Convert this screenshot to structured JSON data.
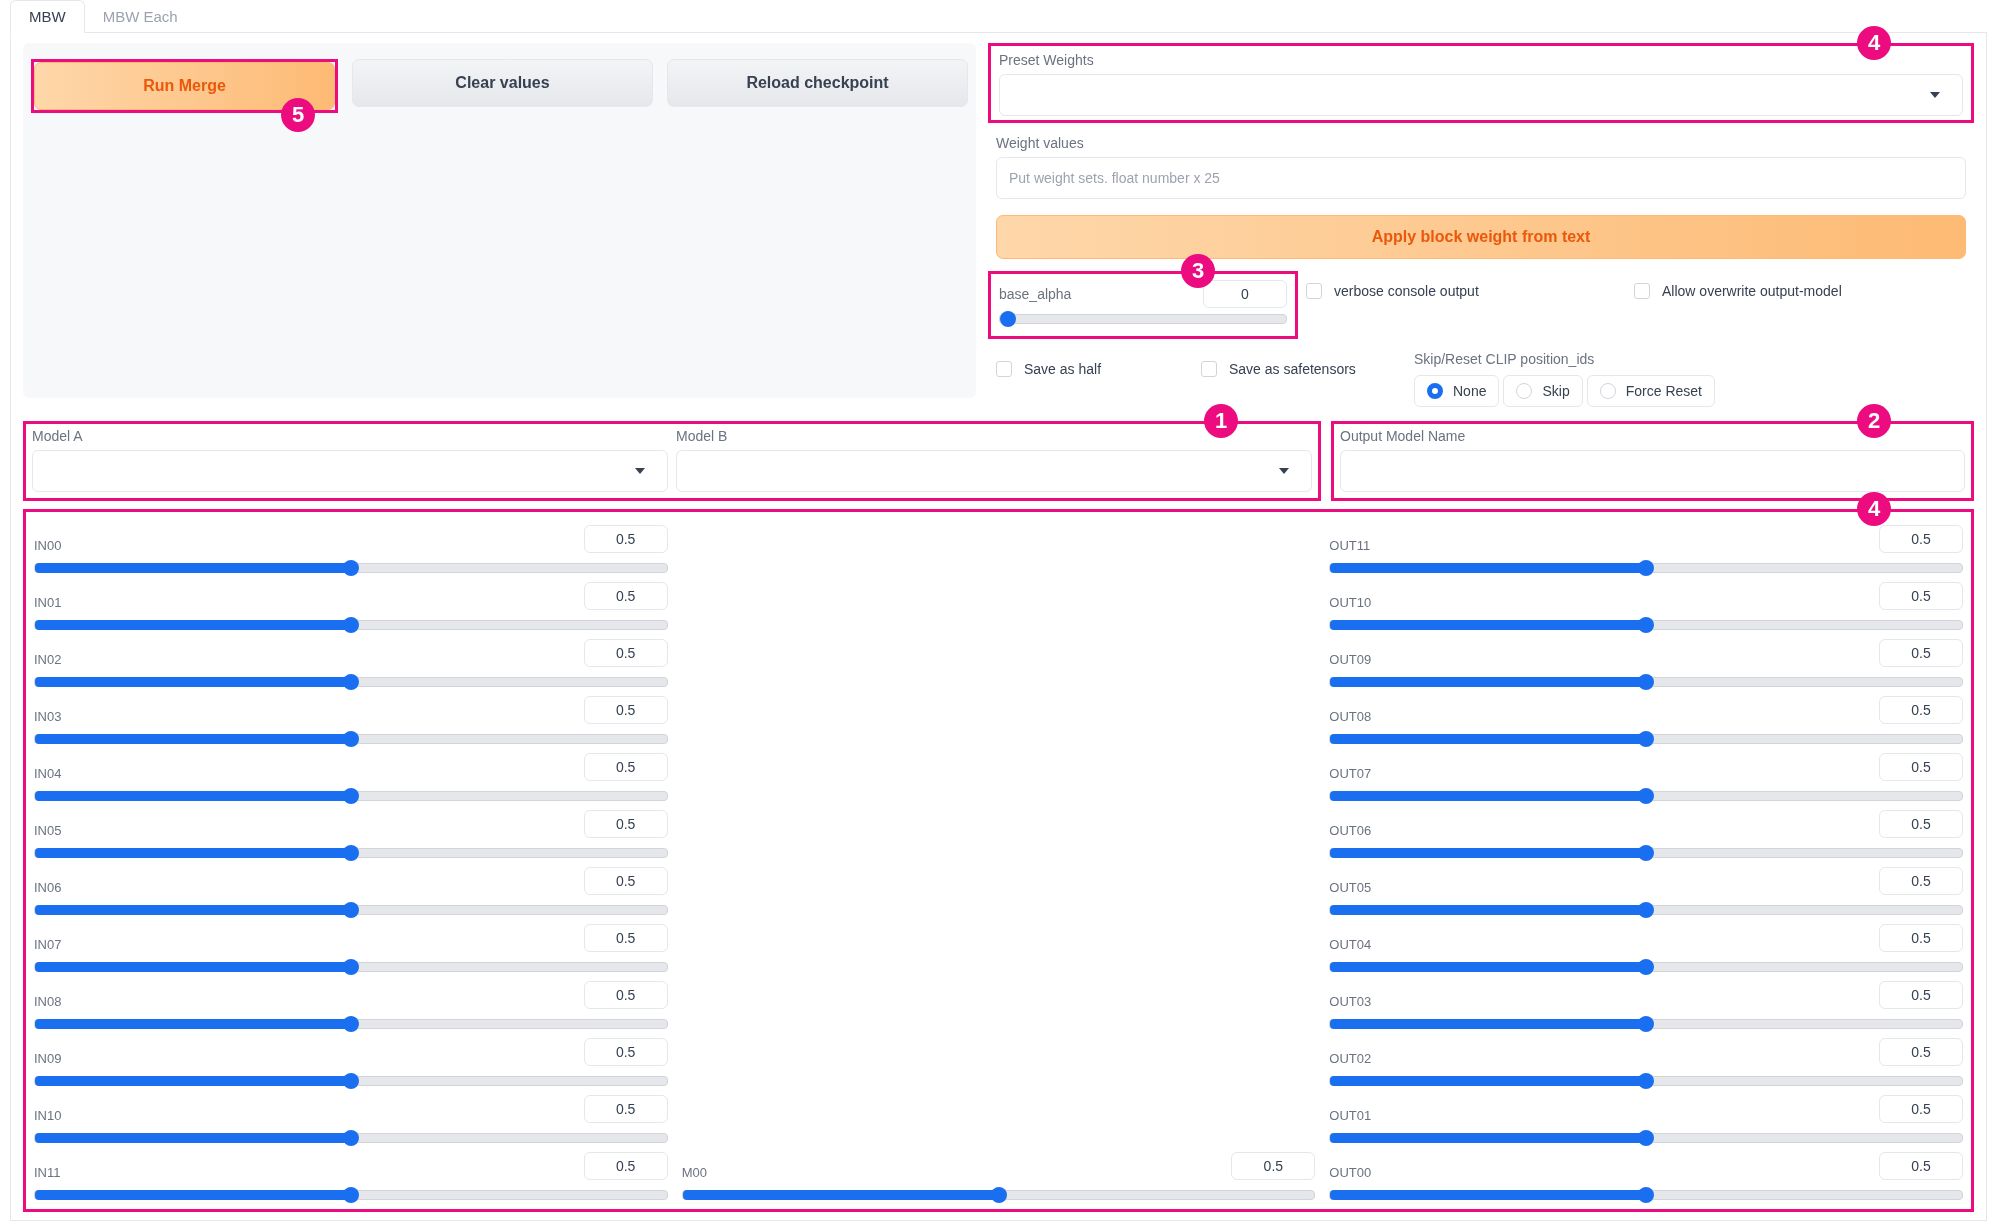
{
  "tabs": [
    {
      "label": "MBW",
      "selected": true
    },
    {
      "label": "MBW Each",
      "selected": false
    }
  ],
  "buttons": [
    {
      "label": "Run Merge",
      "kind": "primary",
      "annotation": "5"
    },
    {
      "label": "Clear values",
      "kind": "secondary"
    },
    {
      "label": "Reload checkpoint",
      "kind": "secondary"
    }
  ],
  "preset_weights": {
    "label": "Preset Weights",
    "annotation": "4"
  },
  "weight_values": {
    "label": "Weight values",
    "placeholder": "Put weight sets. float number x 25"
  },
  "apply_button": "Apply block weight from text",
  "base_alpha": {
    "label": "base_alpha",
    "value": "0",
    "level": 0,
    "annotation": "3"
  },
  "options_row_1": [
    {
      "label": "verbose console output",
      "checked": false
    },
    {
      "label": "Allow overwrite output-model",
      "checked": false
    }
  ],
  "options_row_2": [
    {
      "label": "Save as half",
      "checked": false
    },
    {
      "label": "Save as safetensors",
      "checked": false
    }
  ],
  "clip": {
    "label": "Skip/Reset CLIP position_ids",
    "options": [
      {
        "label": "None",
        "selected": true
      },
      {
        "label": "Skip",
        "selected": false
      },
      {
        "label": "Force Reset",
        "selected": false
      }
    ]
  },
  "models": {
    "annotation": "1",
    "fields": [
      {
        "label": "Model A"
      },
      {
        "label": "Model B"
      }
    ]
  },
  "output_model": {
    "label": "Output Model Name",
    "annotation": "2"
  },
  "blocks": {
    "annotation": "4",
    "in": [
      {
        "label": "IN00",
        "value": "0.5",
        "level": 0.5
      },
      {
        "label": "IN01",
        "value": "0.5",
        "level": 0.5
      },
      {
        "label": "IN02",
        "value": "0.5",
        "level": 0.5
      },
      {
        "label": "IN03",
        "value": "0.5",
        "level": 0.5
      },
      {
        "label": "IN04",
        "value": "0.5",
        "level": 0.5
      },
      {
        "label": "IN05",
        "value": "0.5",
        "level": 0.5
      },
      {
        "label": "IN06",
        "value": "0.5",
        "level": 0.5
      },
      {
        "label": "IN07",
        "value": "0.5",
        "level": 0.5
      },
      {
        "label": "IN08",
        "value": "0.5",
        "level": 0.5
      },
      {
        "label": "IN09",
        "value": "0.5",
        "level": 0.5
      },
      {
        "label": "IN10",
        "value": "0.5",
        "level": 0.5
      },
      {
        "label": "IN11",
        "value": "0.5",
        "level": 0.5
      }
    ],
    "mid": [
      {
        "label": "M00",
        "value": "0.5",
        "level": 0.5
      }
    ],
    "out": [
      {
        "label": "OUT11",
        "value": "0.5",
        "level": 0.5
      },
      {
        "label": "OUT10",
        "value": "0.5",
        "level": 0.5
      },
      {
        "label": "OUT09",
        "value": "0.5",
        "level": 0.5
      },
      {
        "label": "OUT08",
        "value": "0.5",
        "level": 0.5
      },
      {
        "label": "OUT07",
        "value": "0.5",
        "level": 0.5
      },
      {
        "label": "OUT06",
        "value": "0.5",
        "level": 0.5
      },
      {
        "label": "OUT05",
        "value": "0.5",
        "level": 0.5
      },
      {
        "label": "OUT04",
        "value": "0.5",
        "level": 0.5
      },
      {
        "label": "OUT03",
        "value": "0.5",
        "level": 0.5
      },
      {
        "label": "OUT02",
        "value": "0.5",
        "level": 0.5
      },
      {
        "label": "OUT01",
        "value": "0.5",
        "level": 0.5
      },
      {
        "label": "OUT00",
        "value": "0.5",
        "level": 0.5
      }
    ]
  }
}
